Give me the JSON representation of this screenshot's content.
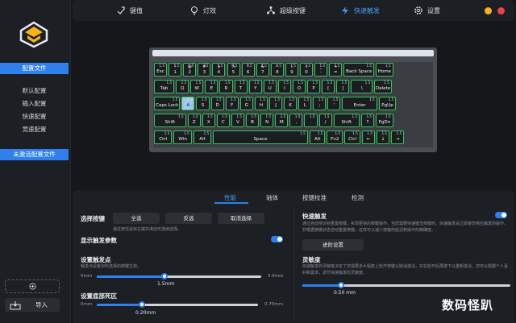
{
  "sidebar": {
    "section_config": "配置文件",
    "profiles": [
      "默认配置",
      "输入配置",
      "快速配置",
      "竞速配置"
    ],
    "section_inactive": "未激活配置文件",
    "import_label": "导入"
  },
  "topbar": {
    "tabs": [
      {
        "label": "键值",
        "icon": "key-hand-icon"
      },
      {
        "label": "灯效",
        "icon": "bulb-icon"
      },
      {
        "label": "超级按键",
        "icon": "super-key-icon"
      },
      {
        "label": "快速触发",
        "icon": "lightning-icon",
        "active": true
      },
      {
        "label": "设置",
        "icon": "gear-icon"
      }
    ],
    "window_dot_colors": [
      "#f5b21b",
      "#e9404a"
    ]
  },
  "keyboard": {
    "default_value": "1.5",
    "highlight_key": {
      "label": "A",
      "value": "1.5"
    },
    "rows": [
      [
        "Esc",
        "1",
        "2",
        "3",
        "4",
        "5",
        "6",
        "7",
        "8",
        "9",
        "0",
        "-",
        "=",
        "Back Space",
        "Home"
      ],
      [
        "Tab",
        "Q",
        "W",
        "E",
        "R",
        "T",
        "Y",
        "U",
        "I",
        "O",
        "P",
        "[",
        "]",
        "\\",
        "Delete"
      ],
      [
        "Caps Lock",
        "A",
        "S",
        "D",
        "F",
        "G",
        "H",
        "J",
        "K",
        "L",
        ";",
        "'",
        "Enter",
        "PgUp"
      ],
      [
        "Shift",
        "Z",
        "X",
        "C",
        "V",
        "B",
        "N",
        "M",
        ",",
        ".",
        "/",
        "Shift",
        "↑",
        "PgDn"
      ],
      [
        "Ctrl",
        "Win",
        "Alt",
        "Space",
        "Alt",
        "Fn2",
        "Ctrl",
        "←",
        "↓",
        "→"
      ]
    ],
    "top_glyphs": [
      "!",
      "@",
      "#",
      "$",
      "%",
      "^",
      "&",
      "*",
      "(",
      ")",
      "_",
      "+"
    ]
  },
  "panel": {
    "tabs": [
      "性能",
      "轴体",
      "按键校准",
      "检测"
    ],
    "active_tab": "性能",
    "select_keys": {
      "label": "选择按键",
      "buttons": [
        "全选",
        "反选",
        "取消选择"
      ],
      "hint": "通过按住鼠标左键并滑动可连续选择。"
    },
    "show_trigger": {
      "label": "显示触发参数",
      "enabled": true
    },
    "trigger_point": {
      "label": "设置触发点",
      "hint": "触发点设置对所选择的按键生效。",
      "min": "0mm",
      "max": "3.6mm",
      "value": "1.5mm",
      "fraction": 0.417
    },
    "bottom_dead": {
      "label": "设置底部死区",
      "min": "0mm",
      "max": "0.70mm",
      "value": "0.20mm",
      "fraction": 0.286
    },
    "rapid_trigger": {
      "label": "快速触发",
      "enabled": true,
      "hint": "通过自动地识别重置按键，实现更快的按键操作。当您需要快速键击按键时，快速触发会立即使您响应触发的操作，并根据按键状态自动重置按键。这样可以减少按键的延迟和操作的精确度。",
      "advanced_button": "进阶设置"
    },
    "sensitivity": {
      "label": "灵敏度",
      "hint": "快速触发的灵敏度决定了您需要多大程度上松开按键以取消激活，并在松开后再按下以重新激活。您可以根据个人喜好和需求，调节快速触发的灵敏度。",
      "value": "0.50 mm",
      "fraction": 0.19
    }
  },
  "watermark": "数码怪趴"
}
